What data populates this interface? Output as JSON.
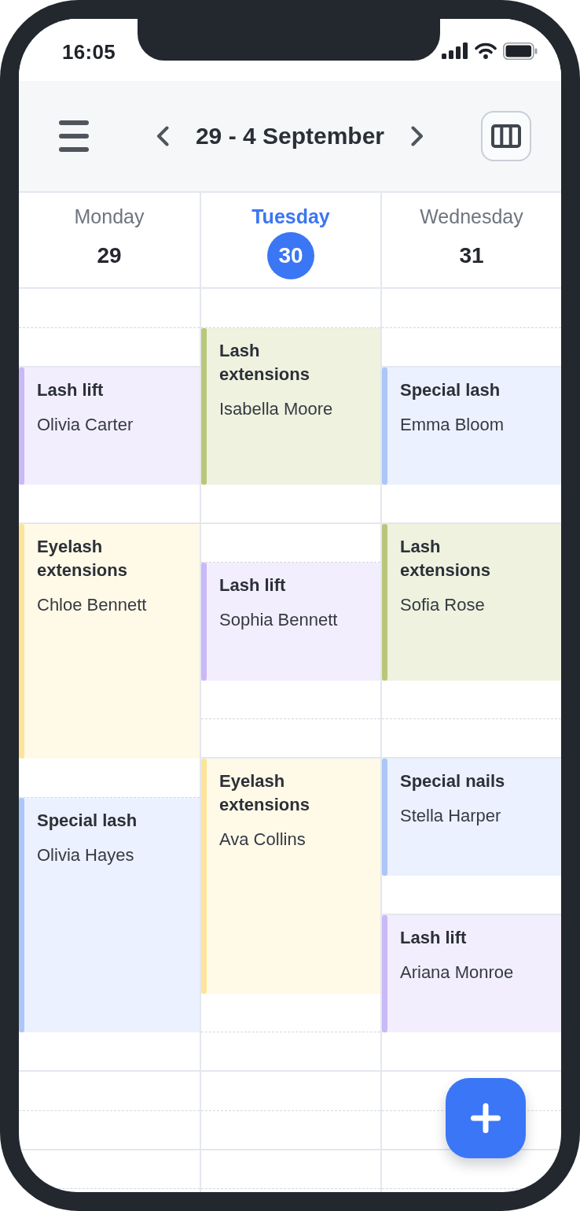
{
  "status_bar": {
    "time": "16:05"
  },
  "header": {
    "title": "29 - 4 September"
  },
  "days": [
    {
      "name": "Monday",
      "date": "29",
      "selected": false,
      "events": [
        {
          "title": "Lash lift",
          "client": "Olivia Carter",
          "color": "#c9b9f7"
        },
        {
          "title": "Eyelash extensions",
          "client": "Chloe Bennett",
          "color": "#fde49b"
        },
        {
          "title": "Special lash",
          "client": "Olivia Hayes",
          "color": "#adc6f9"
        }
      ]
    },
    {
      "name": "Tuesday",
      "date": "30",
      "selected": true,
      "events": [
        {
          "title": "Lash extensions",
          "client": "Isabella Moore",
          "color": "#b9c77b"
        },
        {
          "title": "Lash lift",
          "client": "Sophia Bennett",
          "color": "#c9b9f7"
        },
        {
          "title": "Eyelash extensions",
          "client": "Ava Collins",
          "color": "#fde49b"
        }
      ]
    },
    {
      "name": "Wednesday",
      "date": "31",
      "selected": false,
      "events": [
        {
          "title": "Special lash",
          "client": "Emma Bloom",
          "color": "#adc6f9"
        },
        {
          "title": "Lash extensions",
          "client": "Sofia Rose",
          "color": "#b9c77b"
        },
        {
          "title": "Special nails",
          "client": "Stella Harper",
          "color": "#adc6f9"
        },
        {
          "title": "Lash lift",
          "client": "Ariana Monroe",
          "color": "#c9b9f7"
        }
      ]
    }
  ]
}
